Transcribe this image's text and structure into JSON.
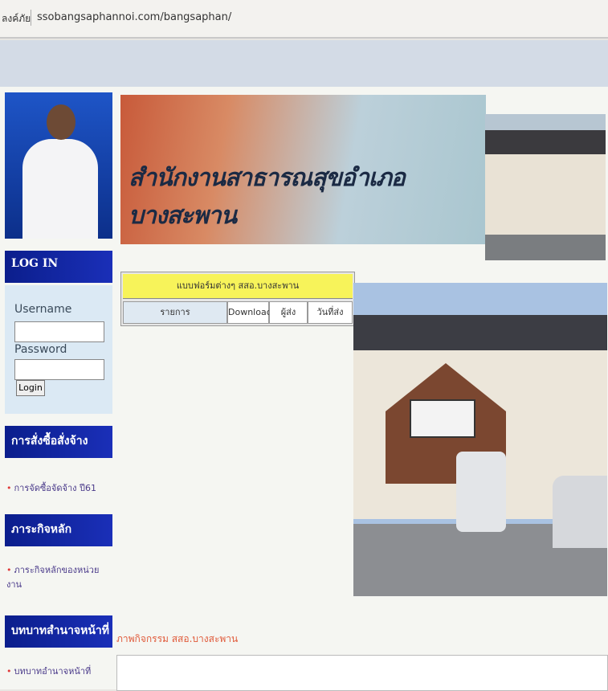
{
  "browser": {
    "tab_label": "ลงค์ภัย",
    "url": "ssobangsaphannoi.com/bangsaphan/"
  },
  "banner": {
    "title": "สำนักงานสาธารณสุขอำเภอบางสะพาน"
  },
  "login": {
    "header": "LOG IN",
    "username_label": "Username",
    "password_label": "Password",
    "button": "Login"
  },
  "sidebar": {
    "sections": [
      {
        "header": "การสั่งซื้อสั่งจ้าง",
        "link": "การจัดซื้อจัดจ้าง ปี61"
      },
      {
        "header": "ภาระกิจหลัก",
        "link": "ภาระกิจหลักของหน่วยงาน"
      },
      {
        "header": "บทบาทสำนาจหน้าที่",
        "link": "บทบาทอำนาจหน้าที่"
      }
    ]
  },
  "forms_table": {
    "title": "แบบฟอร์มต่างๆ สสอ.บางสะพาน",
    "columns": [
      "รายการ",
      "Download",
      "ผู้ส่ง",
      "วันที่ส่ง"
    ]
  },
  "activity_title": "ภาพกิจกรรม สสอ.บางสะพาน",
  "colors": {
    "sidebar_header": "#0b1e8c",
    "forms_title_bg": "#f7f35a",
    "activity_text": "#e05a3a"
  }
}
